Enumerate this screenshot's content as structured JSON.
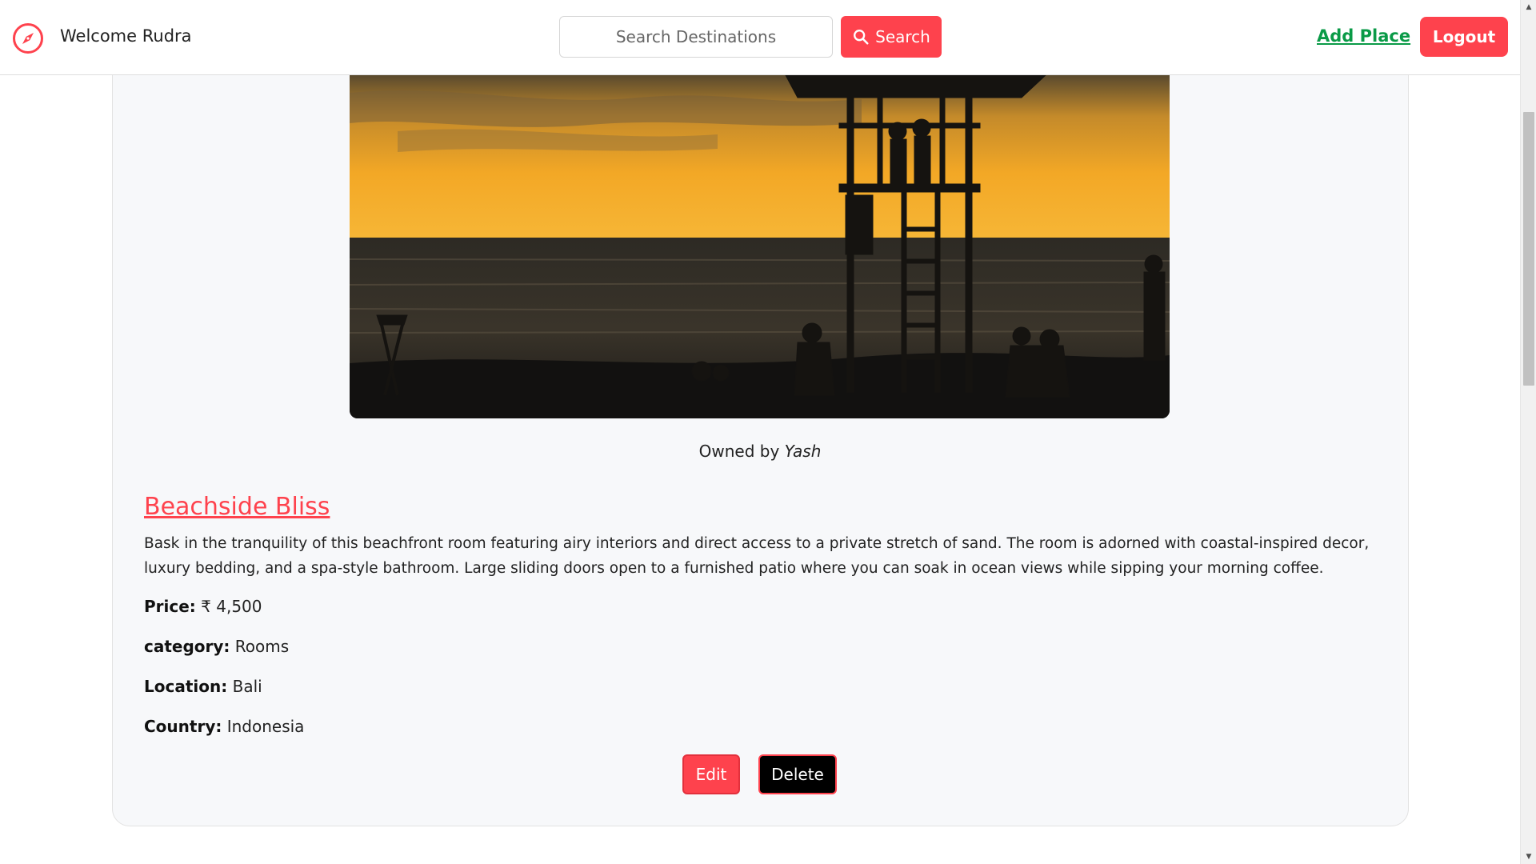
{
  "navbar": {
    "welcome_text": "Welcome Rudra",
    "search_placeholder": "Search Destinations",
    "search_button_label": "Search",
    "add_place_label": "Add Place",
    "logout_label": "Logout",
    "brand_icon": "compass-icon"
  },
  "listing": {
    "image_description_icon": "listing-photo",
    "owner_prefix": "Owned by",
    "owner_name": "Yash",
    "title": "Beachside Bliss",
    "description": "Bask in the tranquility of this beachfront room featuring airy interiors and direct access to a private stretch of sand. The room is adorned with coastal-inspired decor, luxury bedding, and a spa-style bathroom. Large sliding doors open to a furnished patio where you can soak in ocean views while sipping your morning coffee.",
    "price_label": "Price:",
    "price_value": "₹ 4,500",
    "category_label": "category:",
    "category_value": "Rooms",
    "location_label": "Location:",
    "location_value": "Bali",
    "country_label": "Country:",
    "country_value": "Indonesia",
    "edit_label": "Edit",
    "delete_label": "Delete"
  },
  "colors": {
    "accent": "#fe424d",
    "add_place_link": "#0a9a47",
    "card_background": "#f7f8fa"
  },
  "scrollbar": {
    "up_icon": "scroll-up-arrow-icon",
    "down_icon": "scroll-down-arrow-icon"
  }
}
